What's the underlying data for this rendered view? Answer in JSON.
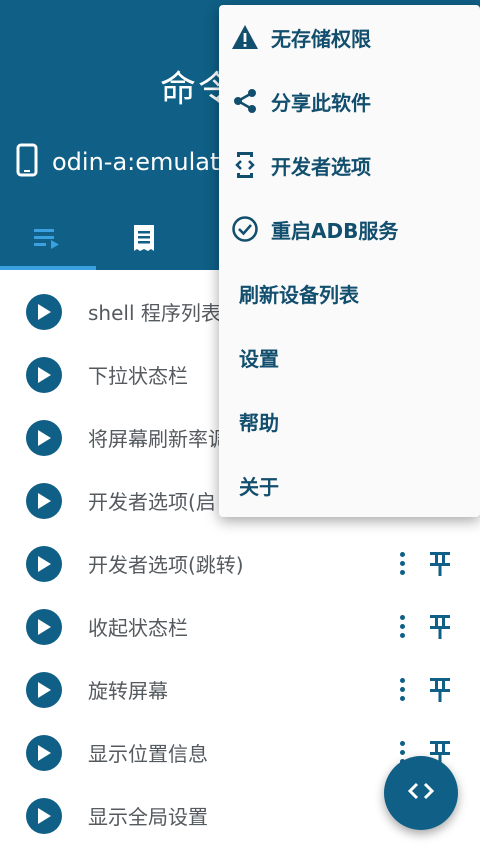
{
  "header": {
    "title": "命令",
    "device_name": "odin-a:emulator",
    "tabs": [
      {
        "icon": "playlist-play-icon",
        "active": true
      },
      {
        "icon": "receipt-icon",
        "active": false
      }
    ]
  },
  "commands": [
    {
      "label": "shell 程序列表"
    },
    {
      "label": "下拉状态栏"
    },
    {
      "label": "将屏幕刷新率调"
    },
    {
      "label": "开发者选项(启"
    },
    {
      "label": "开发者选项(跳转)"
    },
    {
      "label": "收起状态栏"
    },
    {
      "label": "旋转屏幕"
    },
    {
      "label": "显示位置信息"
    },
    {
      "label": "显示全局设置"
    }
  ],
  "menu": {
    "items": [
      {
        "label": "无存储权限",
        "icon": "warning-icon"
      },
      {
        "label": "分享此软件",
        "icon": "share-icon"
      },
      {
        "label": "开发者选项",
        "icon": "developer-mode-icon"
      },
      {
        "label": "重启ADB服务",
        "icon": "check-circle-icon"
      },
      {
        "label": "刷新设备列表"
      },
      {
        "label": "设置"
      },
      {
        "label": "帮助"
      },
      {
        "label": "关于"
      }
    ]
  },
  "colors": {
    "primary": "#0f5f86",
    "menu_text": "#124e6d",
    "list_text": "#555a5f",
    "tab_indicator": "#3aa0e0"
  },
  "fab": {
    "icon": "code-brackets-icon"
  }
}
